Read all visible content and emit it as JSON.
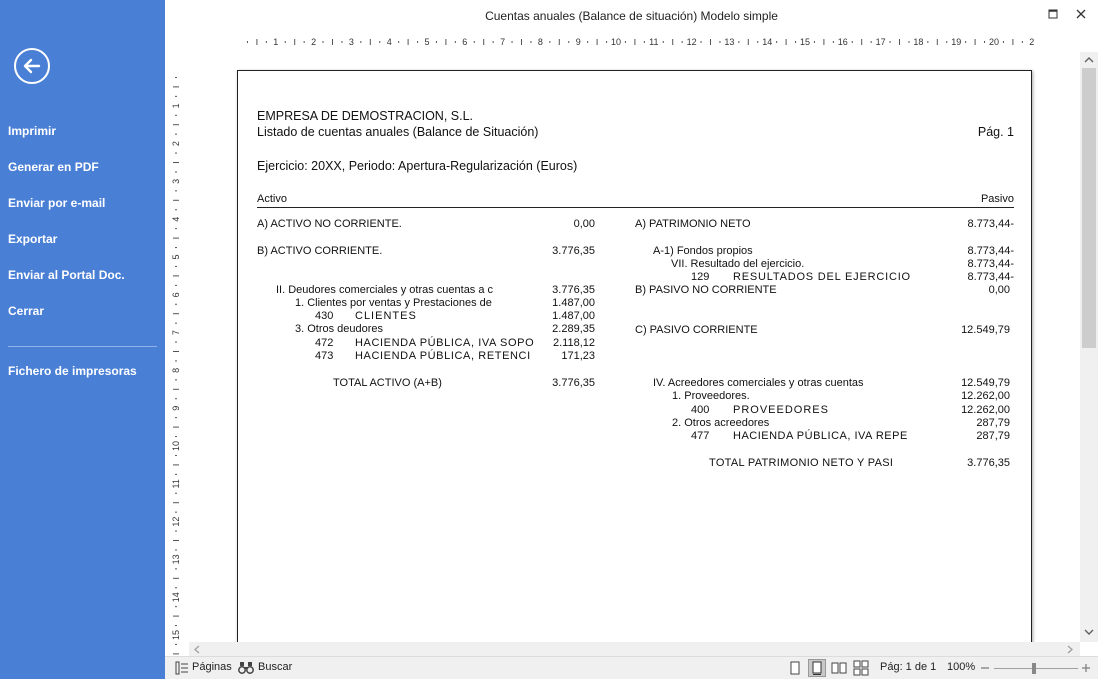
{
  "window": {
    "title": "Cuentas anuales (Balance de situación) Modelo simple"
  },
  "sidebar": {
    "items": [
      {
        "label": "Imprimir"
      },
      {
        "label": "Generar en PDF"
      },
      {
        "label": "Enviar por e-mail"
      },
      {
        "label": "Exportar"
      },
      {
        "label": "Enviar al Portal Doc."
      },
      {
        "label": "Cerrar"
      },
      {
        "label": "Fichero de impresoras"
      }
    ]
  },
  "ruler": {
    "horizontal": [
      "1",
      "2",
      "3",
      "4",
      "5",
      "6",
      "7",
      "8",
      "9",
      "10",
      "11",
      "12",
      "13",
      "14",
      "15",
      "16",
      "17",
      "18",
      "19",
      "20",
      "2"
    ],
    "vertical": [
      "1",
      "2",
      "3",
      "4",
      "5",
      "6",
      "7",
      "8",
      "9",
      "10",
      "11",
      "12",
      "13",
      "14",
      "15"
    ]
  },
  "report": {
    "company": "EMPRESA DE DEMOSTRACION, S.L.",
    "subtitle": "Listado de cuentas anuales (Balance de Situación)",
    "page_label": "Pág. 1",
    "ejercicio": "Ejercicio: 20XX, Periodo: Apertura-Regularización (Euros)",
    "col_activo": "Activo",
    "col_pasivo": "Pasivo",
    "activo": {
      "no_corriente": {
        "label": "A) ACTIVO NO CORRIENTE.",
        "value": "0,00"
      },
      "corriente": {
        "label": "B) ACTIVO CORRIENTE.",
        "value": "3.776,35"
      },
      "deudores": {
        "label": "II. Deudores comerciales y otras cuentas a c",
        "value": "3.776,35"
      },
      "clientes_group": {
        "label": "1. Clientes por ventas y Prestaciones de",
        "value": "1.487,00"
      },
      "acc430": {
        "code": "430",
        "name": "CLIENTES",
        "value": "1.487,00"
      },
      "otros_deudores": {
        "label": "3. Otros deudores",
        "value": "2.289,35"
      },
      "acc472": {
        "code": "472",
        "name": "HACIENDA PÚBLICA, IVA SOPO",
        "value": "2.118,12"
      },
      "acc473": {
        "code": "473",
        "name": "HACIENDA PÚBLICA, RETENCI",
        "value": "171,23"
      },
      "total": {
        "label": "TOTAL ACTIVO (A+B)",
        "value": "3.776,35"
      }
    },
    "pasivo": {
      "patrimonio": {
        "label": "A) PATRIMONIO NETO",
        "value": "8.773,44-"
      },
      "fondos": {
        "label": "A-1) Fondos propios",
        "value": "8.773,44-"
      },
      "resultado": {
        "label": "VII. Resultado del ejercicio.",
        "value": "8.773,44-"
      },
      "acc129": {
        "code": "129",
        "name": "RESULTADOS DEL EJERCICIO",
        "value": "8.773,44-"
      },
      "no_corriente": {
        "label": "B) PASIVO NO CORRIENTE",
        "value": "0,00"
      },
      "corriente": {
        "label": "C) PASIVO CORRIENTE",
        "value": "12.549,79"
      },
      "acreedores": {
        "label": "IV. Acreedores comerciales y otras cuentas",
        "value": "12.549,79"
      },
      "proveedores_group": {
        "label": "1. Proveedores.",
        "value": "12.262,00"
      },
      "acc400": {
        "code": "400",
        "name": "PROVEEDORES",
        "value": "12.262,00"
      },
      "otros_acreedores": {
        "label": "2. Otros acreedores",
        "value": "287,79"
      },
      "acc477": {
        "code": "477",
        "name": "HACIENDA PÚBLICA, IVA REPE",
        "value": "287,79"
      },
      "total": {
        "label": "TOTAL PATRIMONIO NETO Y PASI",
        "value": "3.776,35"
      }
    }
  },
  "statusbar": {
    "pages": "Páginas",
    "search": "Buscar",
    "page_info": "Pág: 1 de 1",
    "zoom": "100%"
  },
  "colors": {
    "sidebar": "#4a7fd6",
    "statusbar": "#f0f0f0"
  }
}
